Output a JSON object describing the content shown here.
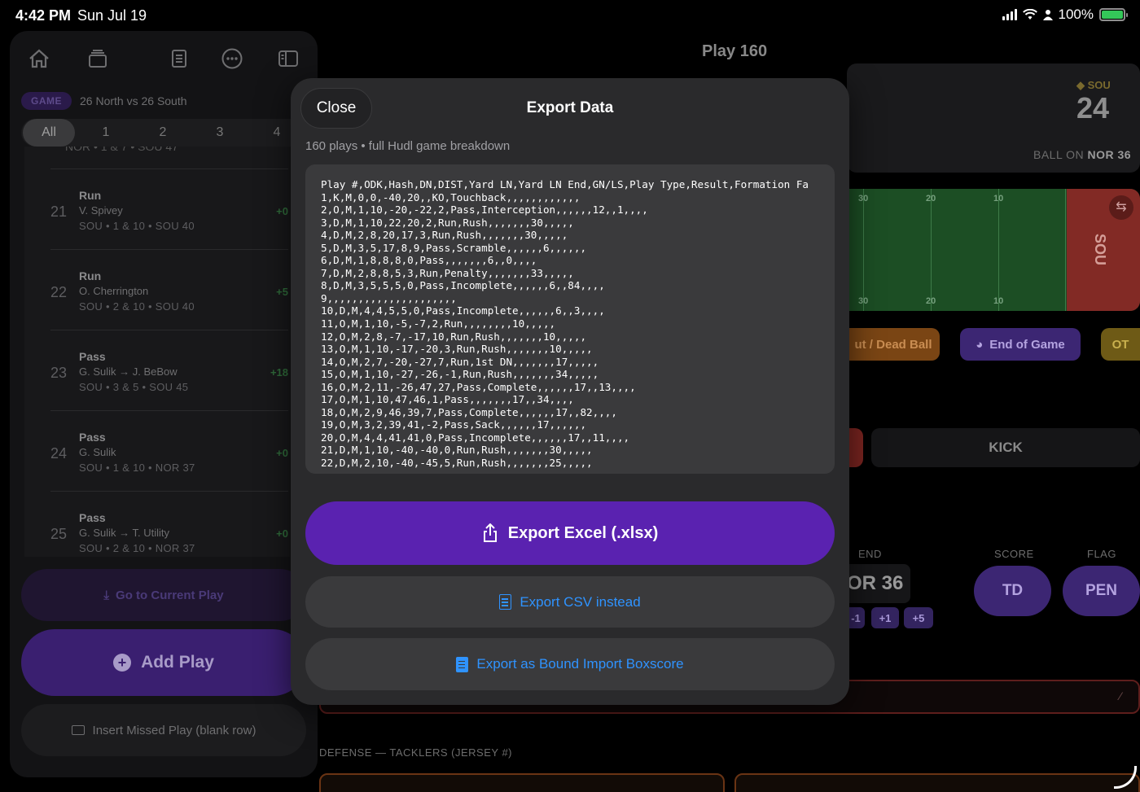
{
  "status_bar": {
    "time": "4:42 PM",
    "date": "Sun Jul 19",
    "battery": "100%"
  },
  "background": {
    "play_title": "Play 160",
    "team": "SOU",
    "team_score": "24",
    "ball_on_label": "BALL ON",
    "ball_on_value": "NOR 36",
    "field_yards_top": [
      "30",
      "20",
      "10"
    ],
    "field_yards_bottom": [
      "30",
      "20",
      "10"
    ],
    "endzone_label": "SOU",
    "buttons": {
      "dead_ball": "ut / Dead Ball",
      "end_of_game": "End of Game",
      "ot": "OT",
      "kick": "KICK"
    },
    "labels": {
      "end": "END",
      "score": "SCORE",
      "flag": "FLAG"
    },
    "end_value": "OR 36",
    "increments": [
      "-1",
      "+1",
      "+5"
    ],
    "score_btn": "TD",
    "flag_btn": "PEN",
    "defense_label": "DEFENSE — TACKLERS (JERSEY #)"
  },
  "sidebar": {
    "game_tag": "GAME",
    "game_name": "26 North vs 26 South",
    "quarters": [
      "All",
      "1",
      "2",
      "3",
      "4"
    ],
    "cut_row": "NOR • 1 & 7 • SOU 47",
    "plays": [
      {
        "num": "21",
        "type": "Run",
        "player": "V. Spivey",
        "meta": "SOU • 1 & 10 • SOU 40",
        "gain": "+0"
      },
      {
        "num": "22",
        "type": "Run",
        "player": "O. Cherrington",
        "meta": "SOU • 2 & 10 • SOU 40",
        "gain": "+5"
      },
      {
        "num": "23",
        "type": "Pass",
        "player": "G. Sulik → J. BeBow",
        "meta": "SOU • 3 & 5 • SOU 45",
        "gain": "+18"
      },
      {
        "num": "24",
        "type": "Pass",
        "player": "G. Sulik",
        "meta": "SOU • 1 & 10 • NOR 37",
        "gain": "+0"
      },
      {
        "num": "25",
        "type": "Pass",
        "player": "G. Sulik → T. Utility",
        "meta": "SOU • 2 & 10 • NOR 37",
        "gain": "+0"
      }
    ],
    "goto_label": "Go to Current Play",
    "add_label": "Add Play",
    "insert_label": "Insert Missed Play (blank row)"
  },
  "modal": {
    "close_label": "Close",
    "title": "Export Data",
    "subtitle": "160 plays • full Hudl game breakdown",
    "csv_lines": [
      "Play #,ODK,Hash,DN,DIST,Yard LN,Yard LN End,GN/LS,Play Type,Result,Formation Fa",
      "1,K,M,0,0,-40,20,,KO,Touchback,,,,,,,,,,,,",
      "2,O,M,1,10,-20,-22,2,Pass,Interception,,,,,,12,,1,,,,",
      "3,D,M,1,10,22,20,2,Run,Rush,,,,,,,30,,,,,",
      "4,D,M,2,8,20,17,3,Run,Rush,,,,,,,30,,,,,",
      "5,D,M,3,5,17,8,9,Pass,Scramble,,,,,,6,,,,,,",
      "6,D,M,1,8,8,8,0,Pass,,,,,,,6,,0,,,,",
      "7,D,M,2,8,8,5,3,Run,Penalty,,,,,,,33,,,,,",
      "8,D,M,3,5,5,5,0,Pass,Incomplete,,,,,,6,,84,,,,",
      "9,,,,,,,,,,,,,,,,,,,,,",
      "10,D,M,4,4,5,5,0,Pass,Incomplete,,,,,,6,,3,,,,",
      "11,O,M,1,10,-5,-7,2,Run,,,,,,,,10,,,,,",
      "12,O,M,2,8,-7,-17,10,Run,Rush,,,,,,,10,,,,,",
      "13,O,M,1,10,-17,-20,3,Run,Rush,,,,,,,10,,,,,",
      "14,O,M,2,7,-20,-27,7,Run,1st DN,,,,,,,17,,,,,",
      "15,O,M,1,10,-27,-26,-1,Run,Rush,,,,,,,34,,,,,",
      "16,O,M,2,11,-26,47,27,Pass,Complete,,,,,,17,,13,,,,",
      "17,O,M,1,10,47,46,1,Pass,,,,,,,17,,34,,,,",
      "18,O,M,2,9,46,39,7,Pass,Complete,,,,,,17,,82,,,,",
      "19,O,M,3,2,39,41,-2,Pass,Sack,,,,,,17,,,,,,",
      "20,O,M,4,4,41,41,0,Pass,Incomplete,,,,,,17,,11,,,,",
      "21,D,M,1,10,-40,-40,0,Run,Rush,,,,,,,30,,,,,",
      "22,D,M,2,10,-40,-45,5,Run,Rush,,,,,,,25,,,,,"
    ],
    "export_xlsx": "Export Excel (.xlsx)",
    "export_csv": "Export CSV instead",
    "export_bound": "Export as Bound Import Boxscore"
  }
}
